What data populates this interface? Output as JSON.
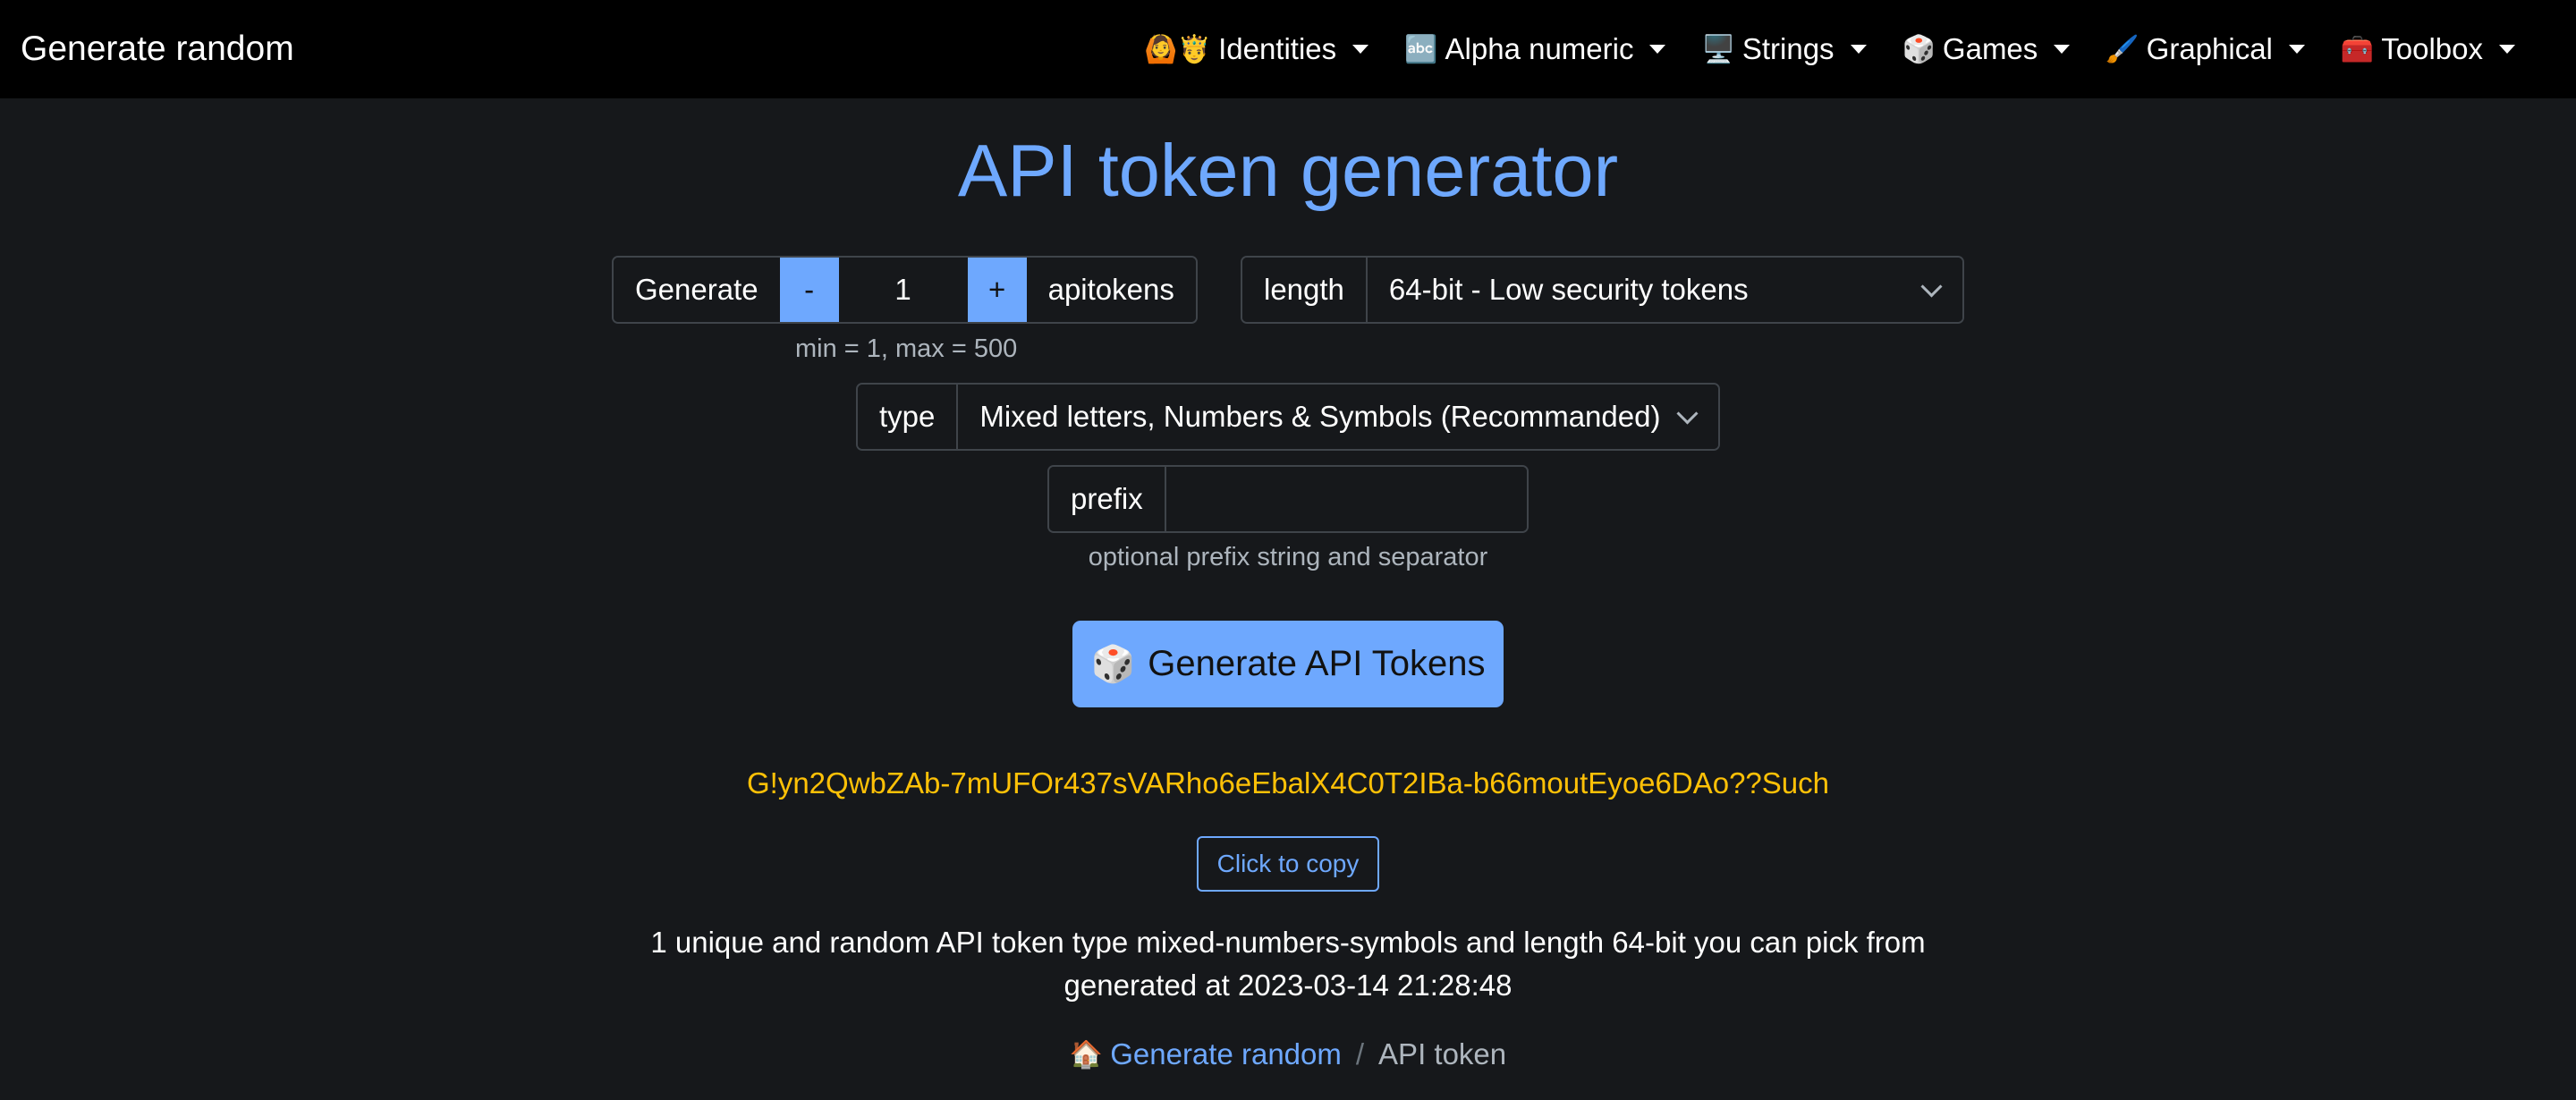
{
  "nav": {
    "brand": "Generate random",
    "items": [
      {
        "icon": "🙆🤴",
        "icon_name": "people-emoji-icon",
        "label": "Identities"
      },
      {
        "icon": "🔤",
        "icon_name": "abc-emoji-icon",
        "label": "Alpha numeric"
      },
      {
        "icon": "🖥️",
        "icon_name": "computer-emoji-icon",
        "label": "Strings"
      },
      {
        "icon": "🎲",
        "icon_name": "dice-emoji-icon",
        "label": "Games"
      },
      {
        "icon": "🖌️",
        "icon_name": "paintbrush-emoji-icon",
        "label": "Graphical"
      },
      {
        "icon": "🧰",
        "icon_name": "toolbox-emoji-icon",
        "label": "Toolbox"
      }
    ]
  },
  "title": "API token generator",
  "quantity": {
    "label": "Generate",
    "minus": "-",
    "value": "1",
    "plus": "+",
    "unit": "apitokens",
    "hint": "min = 1, max = 500"
  },
  "length": {
    "label": "length",
    "selected": "64-bit - Low security tokens"
  },
  "type": {
    "label": "type",
    "selected": "Mixed letters, Numbers & Symbols (Recommanded)"
  },
  "prefix": {
    "label": "prefix",
    "value": "",
    "hint": "optional prefix string and separator"
  },
  "generate_button": {
    "icon": "🎲",
    "label": "Generate API Tokens"
  },
  "result": {
    "token": "G!yn2QwbZAb-7mUFOr437sVARho6eEbalX4C0T2IBa-b66moutEyoe6DAo??Such",
    "copy_label": "Click to copy",
    "summary_line1": "1 unique and random API token type mixed-numbers-symbols and length 64-bit you can pick from",
    "summary_line2": "generated at 2023-03-14 21:28:48"
  },
  "breadcrumb": {
    "home_icon": "🏠",
    "home": "Generate random",
    "divider": "/",
    "current": "API token"
  },
  "colors": {
    "background": "#16181b",
    "navbar": "#000000",
    "accent": "#6ea8fe",
    "token": "#ffc107",
    "border": "#3f444a"
  }
}
